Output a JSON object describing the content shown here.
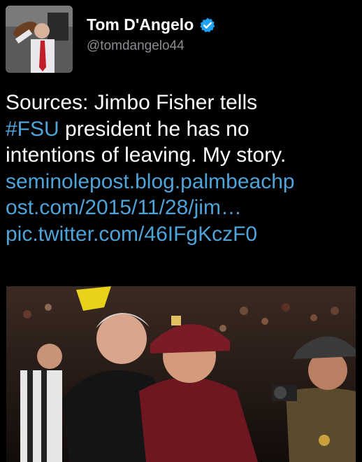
{
  "author": {
    "name": "Tom D'Angelo",
    "handle": "@tomdangelo44",
    "verified": true,
    "avatar_icon": "profile-photo"
  },
  "tweet": {
    "line1": "Sources: Jimbo Fisher tells",
    "hashtag": "#FSU",
    "line2_rest": " president he has no",
    "line3": "intentions of leaving. My story.",
    "link_line1": "seminolepost.blog.palmbeachp",
    "link_line2": "ost.com/2015/11/28/jim…",
    "pic_link": "pic.twitter.com/46IFgKczF0"
  },
  "colors": {
    "background": "#000000",
    "link": "#4ea3d9",
    "handle": "#8a8d91",
    "verified_badge": "#1da1f2"
  }
}
